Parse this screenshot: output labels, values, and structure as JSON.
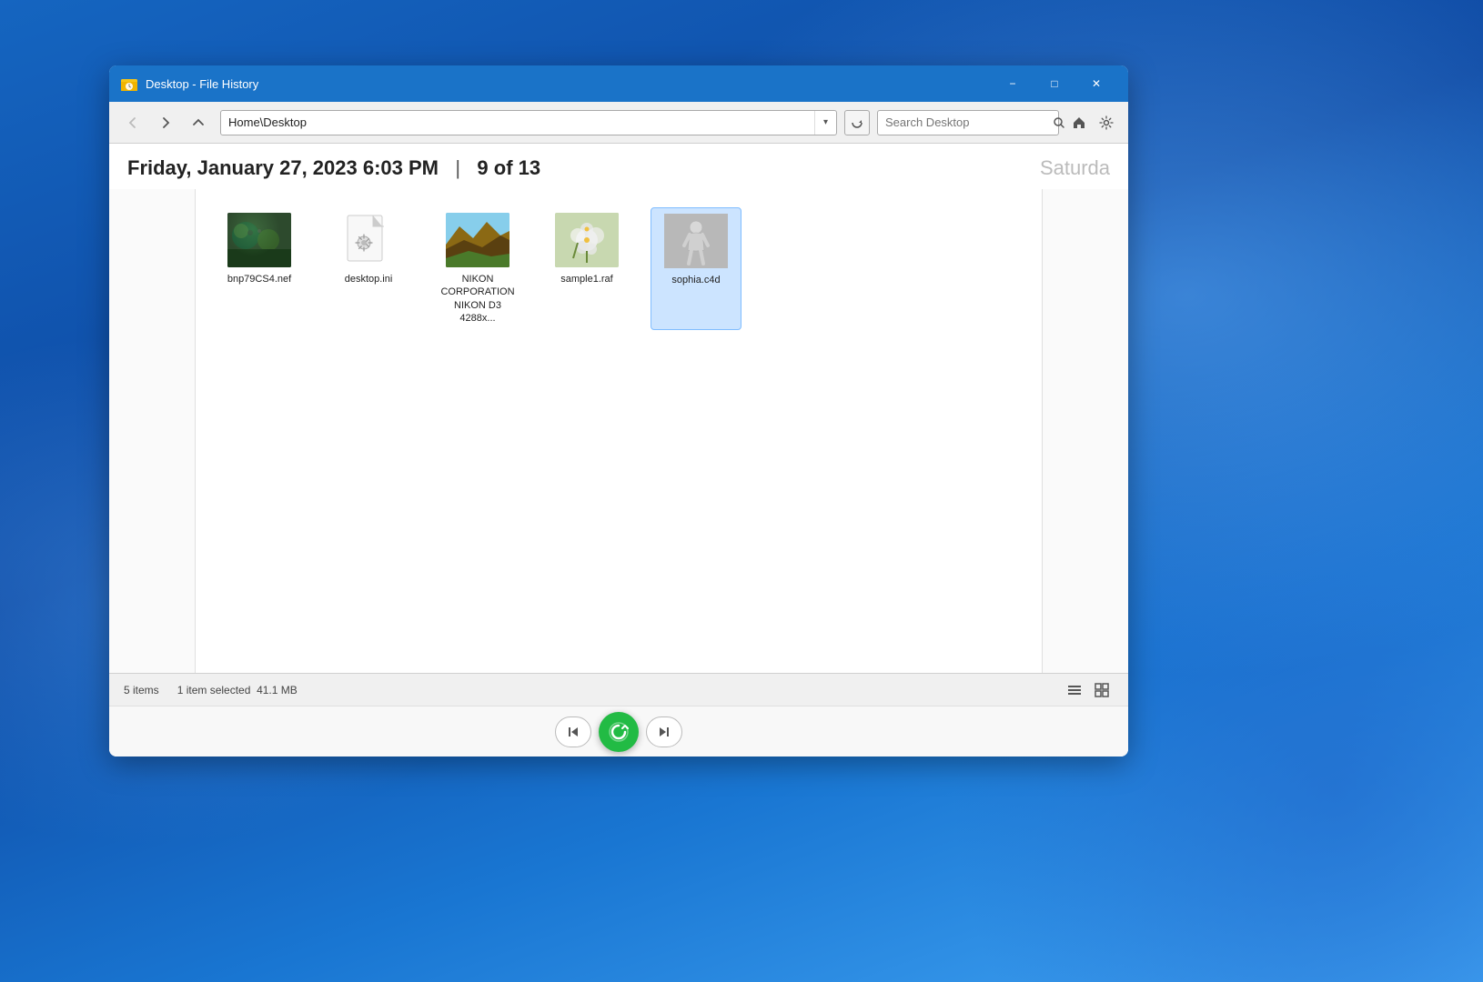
{
  "desktop": {
    "bg_color": "#1565c0"
  },
  "window": {
    "title": "Desktop - File History",
    "icon": "file-history-icon"
  },
  "titlebar": {
    "title": "Desktop - File History",
    "minimize_label": "−",
    "maximize_label": "□",
    "close_label": "✕"
  },
  "toolbar": {
    "back_label": "←",
    "forward_label": "→",
    "up_label": "↑",
    "address": "Home\\Desktop",
    "address_dropdown": "▾",
    "refresh_label": "↻",
    "search_placeholder": "Search Desktop",
    "search_icon": "🔍",
    "home_label": "⌂",
    "settings_label": "⚙"
  },
  "date_header": {
    "current": "Friday, January 27, 2023 6:03 PM",
    "separator": "|",
    "position": "9 of 13",
    "next": "Saturda"
  },
  "files": [
    {
      "name": "bnp79CS4.nef",
      "type": "nef",
      "thumbnail": "dark-green-photo",
      "selected": false
    },
    {
      "name": "desktop.ini",
      "type": "ini",
      "thumbnail": "document-gear",
      "selected": false
    },
    {
      "name": "NIKON CORPORATION NIKON D3 4288x...",
      "type": "nikon-raw",
      "thumbnail": "landscape-photo",
      "selected": false
    },
    {
      "name": "sample1.raf",
      "type": "raf",
      "thumbnail": "flower-photo",
      "selected": false
    },
    {
      "name": "sophia.c4d",
      "type": "c4d",
      "thumbnail": "3d-figure",
      "selected": true
    }
  ],
  "statusbar": {
    "items_count": "5 items",
    "selected_info": "1 item selected",
    "file_size": "41.1 MB",
    "list_view_icon": "≡",
    "tile_view_icon": "□"
  },
  "bottom_controls": {
    "prev_label": "◀",
    "next_label": "▶",
    "restore_icon": "↺"
  }
}
